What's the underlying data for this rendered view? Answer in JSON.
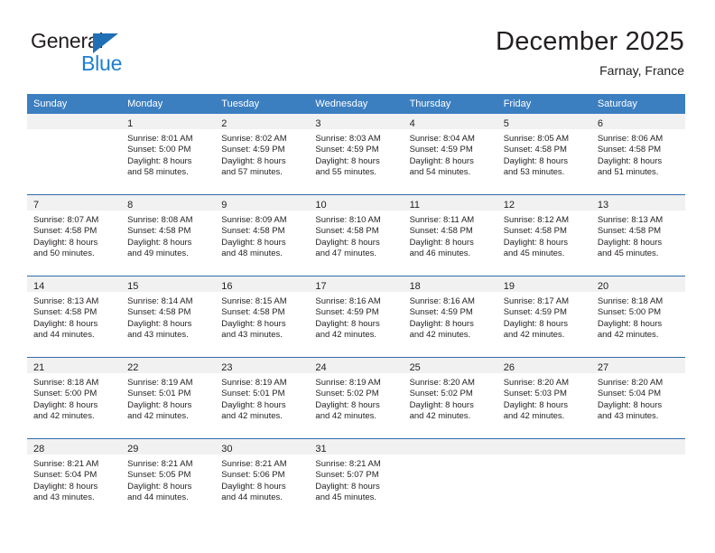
{
  "brand": {
    "name_part1": "General",
    "name_part2": "Blue",
    "accent_color": "#1c7fd1",
    "triangle_color": "#1f6fb5"
  },
  "header": {
    "title": "December 2025",
    "subtitle": "Farnay, France"
  },
  "calendar": {
    "header_bg": "#3c7fc1",
    "header_text_color": "#ffffff",
    "row_divider_color": "#2f6ca8",
    "daynum_band_color": "#f1f1f1",
    "weekdays": [
      "Sunday",
      "Monday",
      "Tuesday",
      "Wednesday",
      "Thursday",
      "Friday",
      "Saturday"
    ],
    "weeks": [
      [
        {
          "day": "",
          "sunrise": "",
          "sunset": "",
          "daylight_line1": "",
          "daylight_line2": "",
          "empty": true
        },
        {
          "day": "1",
          "sunrise": "Sunrise: 8:01 AM",
          "sunset": "Sunset: 5:00 PM",
          "daylight_line1": "Daylight: 8 hours",
          "daylight_line2": "and 58 minutes."
        },
        {
          "day": "2",
          "sunrise": "Sunrise: 8:02 AM",
          "sunset": "Sunset: 4:59 PM",
          "daylight_line1": "Daylight: 8 hours",
          "daylight_line2": "and 57 minutes."
        },
        {
          "day": "3",
          "sunrise": "Sunrise: 8:03 AM",
          "sunset": "Sunset: 4:59 PM",
          "daylight_line1": "Daylight: 8 hours",
          "daylight_line2": "and 55 minutes."
        },
        {
          "day": "4",
          "sunrise": "Sunrise: 8:04 AM",
          "sunset": "Sunset: 4:59 PM",
          "daylight_line1": "Daylight: 8 hours",
          "daylight_line2": "and 54 minutes."
        },
        {
          "day": "5",
          "sunrise": "Sunrise: 8:05 AM",
          "sunset": "Sunset: 4:58 PM",
          "daylight_line1": "Daylight: 8 hours",
          "daylight_line2": "and 53 minutes."
        },
        {
          "day": "6",
          "sunrise": "Sunrise: 8:06 AM",
          "sunset": "Sunset: 4:58 PM",
          "daylight_line1": "Daylight: 8 hours",
          "daylight_line2": "and 51 minutes."
        }
      ],
      [
        {
          "day": "7",
          "sunrise": "Sunrise: 8:07 AM",
          "sunset": "Sunset: 4:58 PM",
          "daylight_line1": "Daylight: 8 hours",
          "daylight_line2": "and 50 minutes."
        },
        {
          "day": "8",
          "sunrise": "Sunrise: 8:08 AM",
          "sunset": "Sunset: 4:58 PM",
          "daylight_line1": "Daylight: 8 hours",
          "daylight_line2": "and 49 minutes."
        },
        {
          "day": "9",
          "sunrise": "Sunrise: 8:09 AM",
          "sunset": "Sunset: 4:58 PM",
          "daylight_line1": "Daylight: 8 hours",
          "daylight_line2": "and 48 minutes."
        },
        {
          "day": "10",
          "sunrise": "Sunrise: 8:10 AM",
          "sunset": "Sunset: 4:58 PM",
          "daylight_line1": "Daylight: 8 hours",
          "daylight_line2": "and 47 minutes."
        },
        {
          "day": "11",
          "sunrise": "Sunrise: 8:11 AM",
          "sunset": "Sunset: 4:58 PM",
          "daylight_line1": "Daylight: 8 hours",
          "daylight_line2": "and 46 minutes."
        },
        {
          "day": "12",
          "sunrise": "Sunrise: 8:12 AM",
          "sunset": "Sunset: 4:58 PM",
          "daylight_line1": "Daylight: 8 hours",
          "daylight_line2": "and 45 minutes."
        },
        {
          "day": "13",
          "sunrise": "Sunrise: 8:13 AM",
          "sunset": "Sunset: 4:58 PM",
          "daylight_line1": "Daylight: 8 hours",
          "daylight_line2": "and 45 minutes."
        }
      ],
      [
        {
          "day": "14",
          "sunrise": "Sunrise: 8:13 AM",
          "sunset": "Sunset: 4:58 PM",
          "daylight_line1": "Daylight: 8 hours",
          "daylight_line2": "and 44 minutes."
        },
        {
          "day": "15",
          "sunrise": "Sunrise: 8:14 AM",
          "sunset": "Sunset: 4:58 PM",
          "daylight_line1": "Daylight: 8 hours",
          "daylight_line2": "and 43 minutes."
        },
        {
          "day": "16",
          "sunrise": "Sunrise: 8:15 AM",
          "sunset": "Sunset: 4:58 PM",
          "daylight_line1": "Daylight: 8 hours",
          "daylight_line2": "and 43 minutes."
        },
        {
          "day": "17",
          "sunrise": "Sunrise: 8:16 AM",
          "sunset": "Sunset: 4:59 PM",
          "daylight_line1": "Daylight: 8 hours",
          "daylight_line2": "and 42 minutes."
        },
        {
          "day": "18",
          "sunrise": "Sunrise: 8:16 AM",
          "sunset": "Sunset: 4:59 PM",
          "daylight_line1": "Daylight: 8 hours",
          "daylight_line2": "and 42 minutes."
        },
        {
          "day": "19",
          "sunrise": "Sunrise: 8:17 AM",
          "sunset": "Sunset: 4:59 PM",
          "daylight_line1": "Daylight: 8 hours",
          "daylight_line2": "and 42 minutes."
        },
        {
          "day": "20",
          "sunrise": "Sunrise: 8:18 AM",
          "sunset": "Sunset: 5:00 PM",
          "daylight_line1": "Daylight: 8 hours",
          "daylight_line2": "and 42 minutes."
        }
      ],
      [
        {
          "day": "21",
          "sunrise": "Sunrise: 8:18 AM",
          "sunset": "Sunset: 5:00 PM",
          "daylight_line1": "Daylight: 8 hours",
          "daylight_line2": "and 42 minutes."
        },
        {
          "day": "22",
          "sunrise": "Sunrise: 8:19 AM",
          "sunset": "Sunset: 5:01 PM",
          "daylight_line1": "Daylight: 8 hours",
          "daylight_line2": "and 42 minutes."
        },
        {
          "day": "23",
          "sunrise": "Sunrise: 8:19 AM",
          "sunset": "Sunset: 5:01 PM",
          "daylight_line1": "Daylight: 8 hours",
          "daylight_line2": "and 42 minutes."
        },
        {
          "day": "24",
          "sunrise": "Sunrise: 8:19 AM",
          "sunset": "Sunset: 5:02 PM",
          "daylight_line1": "Daylight: 8 hours",
          "daylight_line2": "and 42 minutes."
        },
        {
          "day": "25",
          "sunrise": "Sunrise: 8:20 AM",
          "sunset": "Sunset: 5:02 PM",
          "daylight_line1": "Daylight: 8 hours",
          "daylight_line2": "and 42 minutes."
        },
        {
          "day": "26",
          "sunrise": "Sunrise: 8:20 AM",
          "sunset": "Sunset: 5:03 PM",
          "daylight_line1": "Daylight: 8 hours",
          "daylight_line2": "and 42 minutes."
        },
        {
          "day": "27",
          "sunrise": "Sunrise: 8:20 AM",
          "sunset": "Sunset: 5:04 PM",
          "daylight_line1": "Daylight: 8 hours",
          "daylight_line2": "and 43 minutes."
        }
      ],
      [
        {
          "day": "28",
          "sunrise": "Sunrise: 8:21 AM",
          "sunset": "Sunset: 5:04 PM",
          "daylight_line1": "Daylight: 8 hours",
          "daylight_line2": "and 43 minutes."
        },
        {
          "day": "29",
          "sunrise": "Sunrise: 8:21 AM",
          "sunset": "Sunset: 5:05 PM",
          "daylight_line1": "Daylight: 8 hours",
          "daylight_line2": "and 44 minutes."
        },
        {
          "day": "30",
          "sunrise": "Sunrise: 8:21 AM",
          "sunset": "Sunset: 5:06 PM",
          "daylight_line1": "Daylight: 8 hours",
          "daylight_line2": "and 44 minutes."
        },
        {
          "day": "31",
          "sunrise": "Sunrise: 8:21 AM",
          "sunset": "Sunset: 5:07 PM",
          "daylight_line1": "Daylight: 8 hours",
          "daylight_line2": "and 45 minutes."
        },
        {
          "day": "",
          "sunrise": "",
          "sunset": "",
          "daylight_line1": "",
          "daylight_line2": "",
          "empty": true
        },
        {
          "day": "",
          "sunrise": "",
          "sunset": "",
          "daylight_line1": "",
          "daylight_line2": "",
          "empty": true
        },
        {
          "day": "",
          "sunrise": "",
          "sunset": "",
          "daylight_line1": "",
          "daylight_line2": "",
          "empty": true
        }
      ]
    ]
  }
}
